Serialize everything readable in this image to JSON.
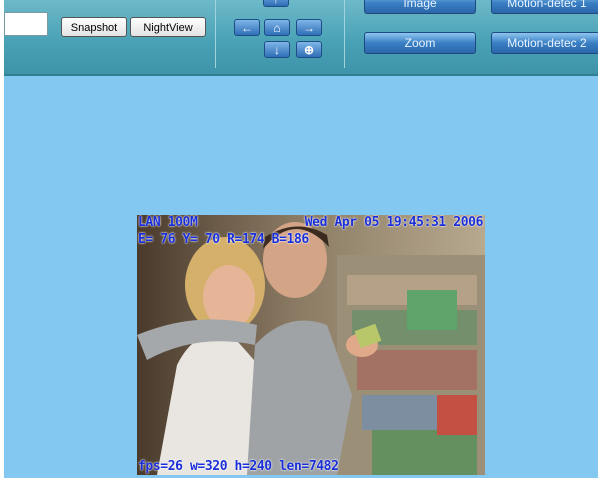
{
  "toolbar": {
    "snapshot_label": "Snapshot",
    "nightview_label": "NightView",
    "arrows": {
      "up": "↑",
      "left": "←",
      "home": "⌂",
      "right": "→",
      "down": "↓",
      "center": "⊕"
    },
    "image_label": "Image",
    "zoom_label": "Zoom",
    "motion1_label": "Motion-detec 1",
    "motion2_label": "Motion-detec 2"
  },
  "video": {
    "osd_top_left": "LAN 100M",
    "osd_top_right": "Wed Apr 05 19:45:31 2006",
    "osd_levels": "E= 76 Y= 70 R=174 B=186",
    "osd_stats": "fps=26 w=320 h=240 len=7482"
  },
  "colors": {
    "toolbar": "#4aa2b6",
    "canvas_bg": "#82c8f0",
    "osd_text": "#1b2fd8"
  }
}
